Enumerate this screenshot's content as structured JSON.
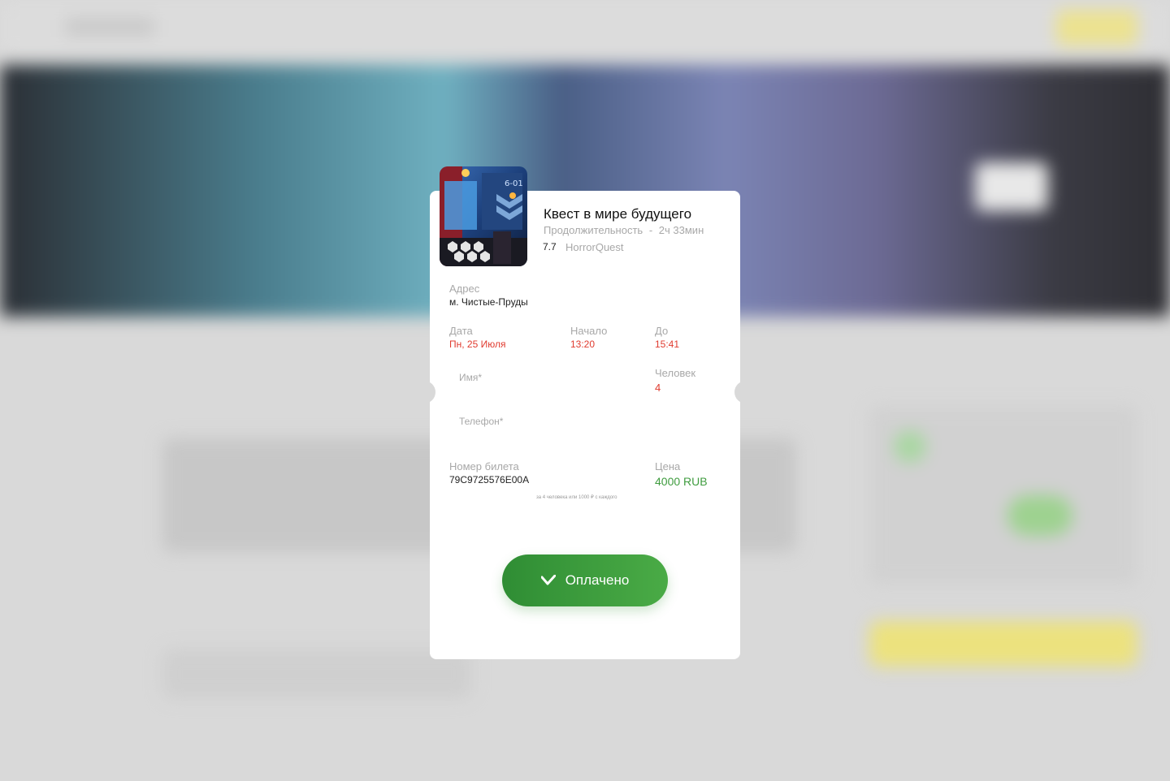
{
  "ticket": {
    "title": "Квест в мире будущего",
    "duration_label": "Продолжительность",
    "duration_sep": "-",
    "duration_value": "2ч 33мин",
    "rating": "7.7",
    "organizer": "HorrorQuest",
    "address_label": "Адрес",
    "address_value": "м. Чистые-Пруды",
    "date_label": "Дата",
    "date_value": "Пн, 25 Июля",
    "start_label": "Начало",
    "start_value": "13:20",
    "end_label": "До",
    "end_value": "15:41",
    "name_placeholder": "Имя*",
    "people_label": "Человек",
    "people_value": "4",
    "phone_placeholder": "Телефон*",
    "ticket_number_label": "Номер билета",
    "ticket_number_value": "79C9725576E00A",
    "price_label": "Цена",
    "price_value": "4000 RUB",
    "price_note": "за 4 человека или 1000 ₽ с каждого",
    "paid_button": "Оплачено"
  },
  "icons": {
    "check": "check-icon"
  },
  "colors": {
    "accent_red": "#e03b2f",
    "accent_green": "#3f9c3f",
    "button_green": "#3a9a3d"
  }
}
